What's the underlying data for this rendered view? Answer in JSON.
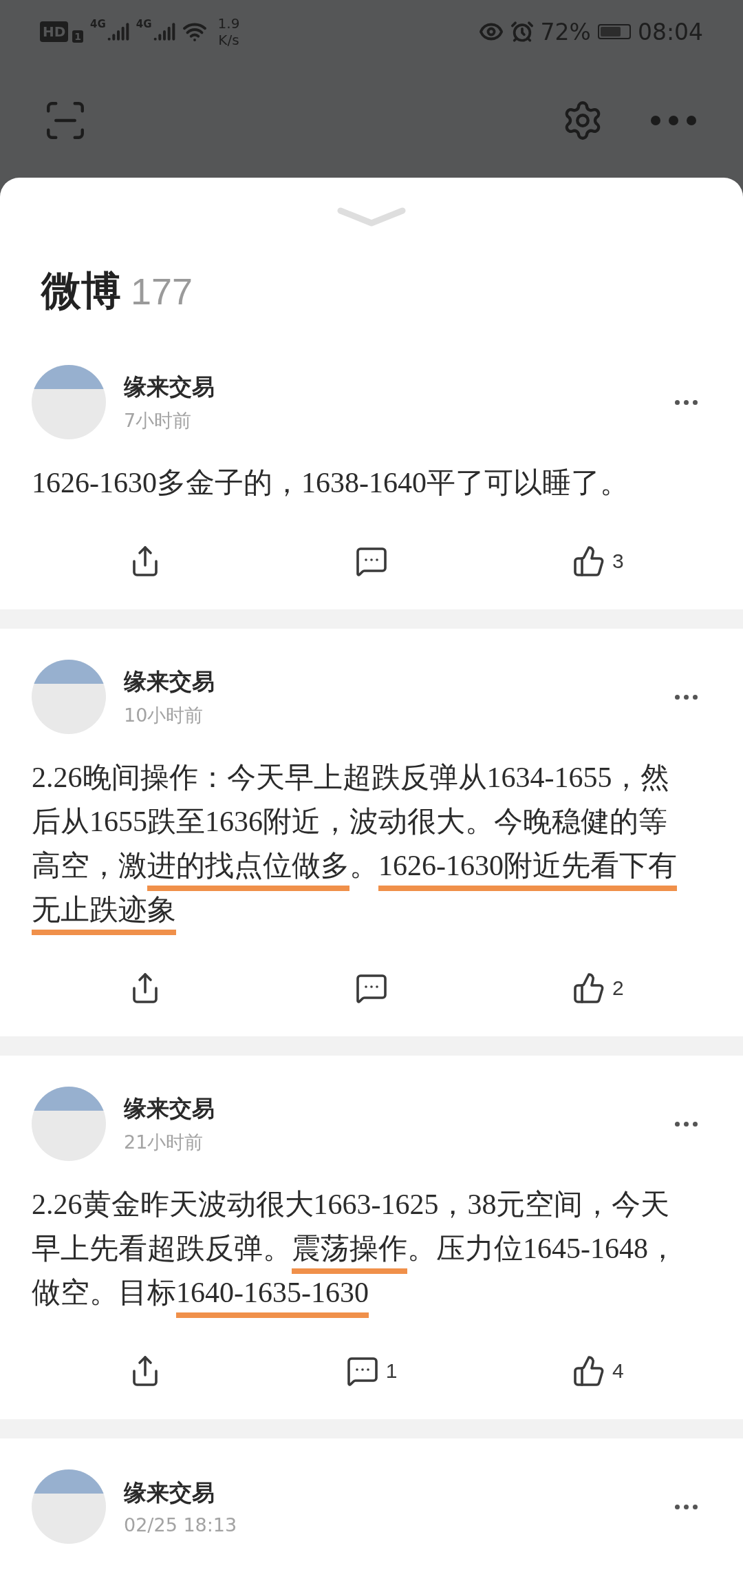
{
  "status_bar": {
    "hd": "HD",
    "sim": "1",
    "networks": [
      "4G",
      "4G"
    ],
    "speed": "1.9",
    "speed_unit": "K/s",
    "battery": "72%",
    "time": "08:04"
  },
  "section": {
    "title": "微博",
    "count": "177"
  },
  "posts": [
    {
      "author": "缘来交易",
      "time": "7小时前",
      "segments": [
        {
          "text": "1626-1630多金子的，1638-1640平了可以睡了。",
          "underlined": false
        }
      ],
      "likes": "3"
    },
    {
      "author": "缘来交易",
      "time": "10小时前",
      "segments": [
        {
          "text": "2.26晚间操作：今天早上超跌反弹从1634-1655，然后从1655跌至1636附近，波动很大。今晚稳健的等高空，激",
          "underlined": false
        },
        {
          "text": "进的找点位做多",
          "underlined": true
        },
        {
          "text": "。",
          "underlined": false
        },
        {
          "text": "1626-1630附近先看下有无止跌迹象",
          "underlined": true
        }
      ],
      "likes": "2"
    },
    {
      "author": "缘来交易",
      "time": "21小时前",
      "segments": [
        {
          "text": "2.26黄金昨天波动很大1663-1625，38元空间，今天早上先看超跌反弹。",
          "underlined": false
        },
        {
          "text": "震荡操作",
          "underlined": true
        },
        {
          "text": "。压力位1645-1648，做空。目标",
          "underlined": false
        },
        {
          "text": "1640-1635-1630",
          "underlined": true
        }
      ],
      "comments": "1",
      "likes": "4"
    },
    {
      "author": "缘来交易",
      "time": "02/25 18:13"
    }
  ]
}
